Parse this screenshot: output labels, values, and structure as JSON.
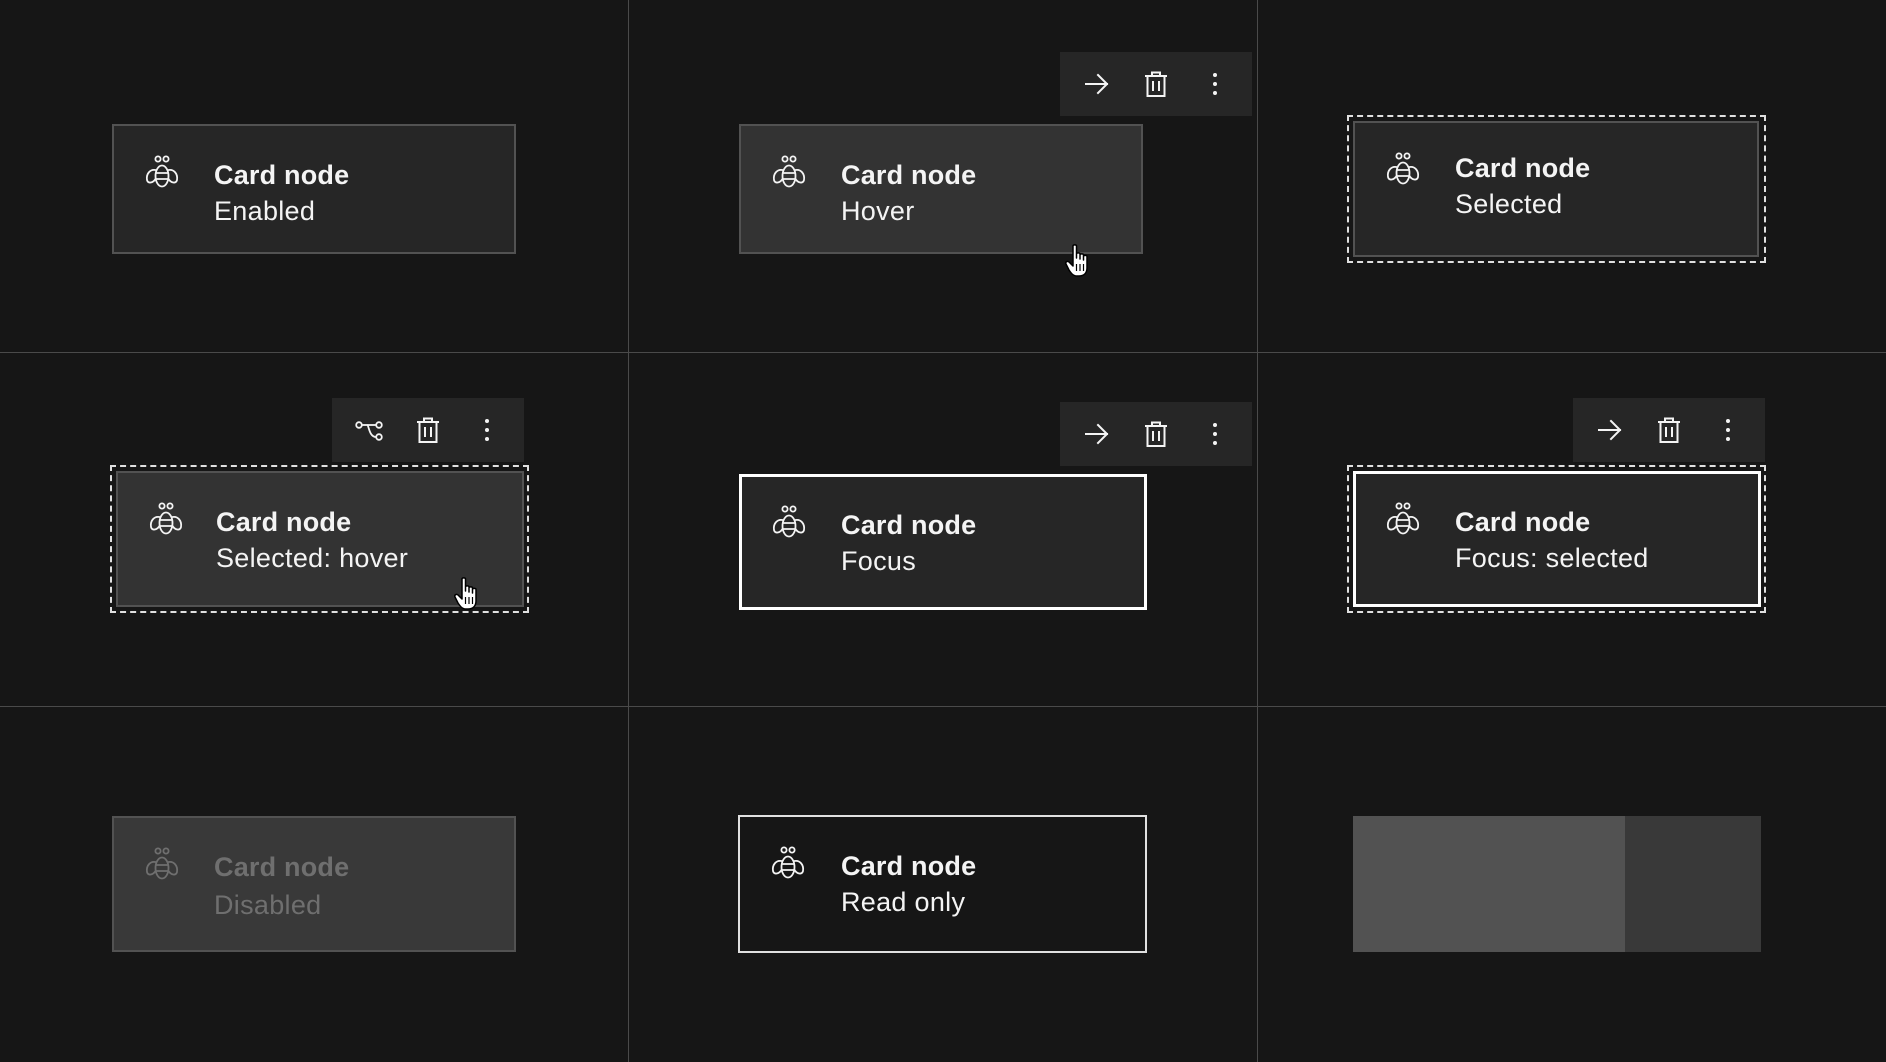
{
  "colors": {
    "background": "#161616",
    "card": "#262626",
    "card_hover": "#333333",
    "border": "#525252",
    "focus": "#ffffff",
    "divider": "#4a4a4a"
  },
  "cards": {
    "enabled": {
      "title": "Card node",
      "subtitle": "Enabled"
    },
    "hover": {
      "title": "Card node",
      "subtitle": "Hover"
    },
    "selected": {
      "title": "Card node",
      "subtitle": "Selected"
    },
    "selected_hover": {
      "title": "Card node",
      "subtitle": "Selected: hover"
    },
    "focus": {
      "title": "Card node",
      "subtitle": "Focus"
    },
    "focus_selected": {
      "title": "Card node",
      "subtitle": "Focus: selected"
    },
    "disabled": {
      "title": "Card node",
      "subtitle": "Disabled"
    },
    "read_only": {
      "title": "Card node",
      "subtitle": "Read only"
    }
  },
  "icons": {
    "node": "bee-icon",
    "toolbar_primary": "arrow-right-icon",
    "toolbar_primary_alt": "connect-icon",
    "delete": "trash-can-icon",
    "overflow": "overflow-menu-vertical-icon",
    "pointer": "hand-pointer-icon"
  }
}
